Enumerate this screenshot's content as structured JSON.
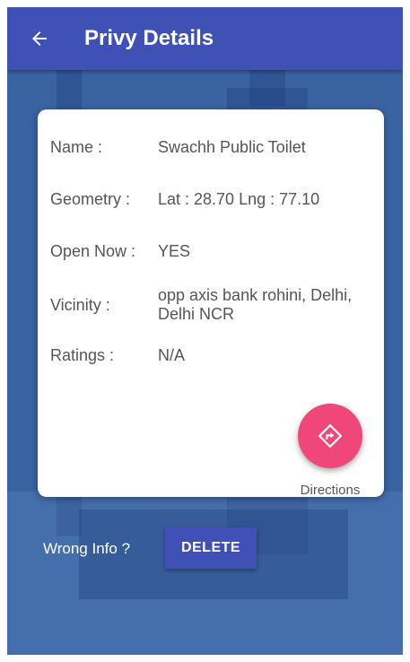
{
  "appbar": {
    "title": "Privy Details",
    "back_icon": "arrow-left-icon"
  },
  "details": {
    "name_label": "Name :",
    "name_value": "Swachh Public Toilet",
    "geometry_label": "Geometry :",
    "geometry_value": "Lat : 28.70 Lng : 77.10",
    "open_label": "Open Now :",
    "open_value": "YES",
    "vicinity_label": "Vicinity :",
    "vicinity_value": "opp axis bank rohini, Delhi, Delhi NCR",
    "ratings_label": "Ratings :",
    "ratings_value": "N/A"
  },
  "directions": {
    "label": "Directions",
    "icon": "directions-icon"
  },
  "footer": {
    "wrong_info_label": "Wrong Info ?",
    "delete_label": "DELETE"
  },
  "colors": {
    "appbar": "#3f51b5",
    "background": "#3a63a2",
    "fab": "#f0477a",
    "delete_button": "#3f51b5"
  }
}
